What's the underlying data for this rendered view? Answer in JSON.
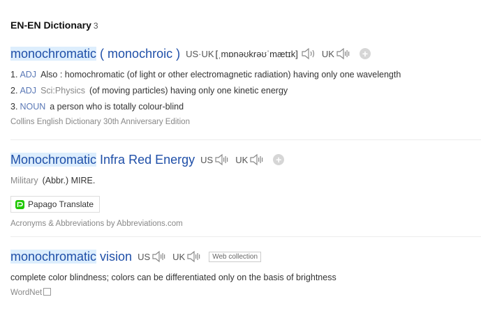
{
  "section": {
    "title": "EN-EN Dictionary",
    "count": "3"
  },
  "entries": [
    {
      "headword_hl": "monochromatic",
      "headword_rest": " ( monochroic )",
      "pron_us_label": "US·UK",
      "ipa": "[ˌmɒnəʊkrəʊˈmætɪk]",
      "pron_uk_label": "UK",
      "defs": [
        {
          "num": "1.",
          "pos": "ADJ",
          "field": "",
          "text": "Also : homochromatic (of light or other electromagnetic radiation) having only one wavelength"
        },
        {
          "num": "2.",
          "pos": "ADJ",
          "field": "Sci:Physics",
          "text": "(of moving particles) having only one kinetic energy"
        },
        {
          "num": "3.",
          "pos": "NOUN",
          "field": "",
          "text": "a person who is totally colour-blind"
        }
      ],
      "source": "Collins English Dictionary 30th Anniversary Edition"
    },
    {
      "headword_hl": "Monochromatic",
      "headword_rest": " Infra Red Energy",
      "pron_us_label": "US",
      "pron_uk_label": "UK",
      "field": "Military",
      "text": "(Abbr.) MIRE.",
      "papago_label": "Papago Translate",
      "source": "Acronyms & Abbreviations by Abbreviations.com"
    },
    {
      "headword_hl": "monochromatic",
      "headword_rest": " vision",
      "pron_us_label": "US",
      "pron_uk_label": "UK",
      "tag": "Web collection",
      "text": "complete color blindness; colors can be differentiated only on the basis of brightness",
      "source": "WordNet"
    }
  ],
  "icons": {
    "speaker": "speaker-icon",
    "add": "plus-circle-icon",
    "papago": "papago-logo-icon",
    "copy": "copy-icon"
  },
  "colors": {
    "headword": "#1f4fa8",
    "highlight": "#ddeefd",
    "pos": "#5a78b6",
    "source": "#888888"
  }
}
